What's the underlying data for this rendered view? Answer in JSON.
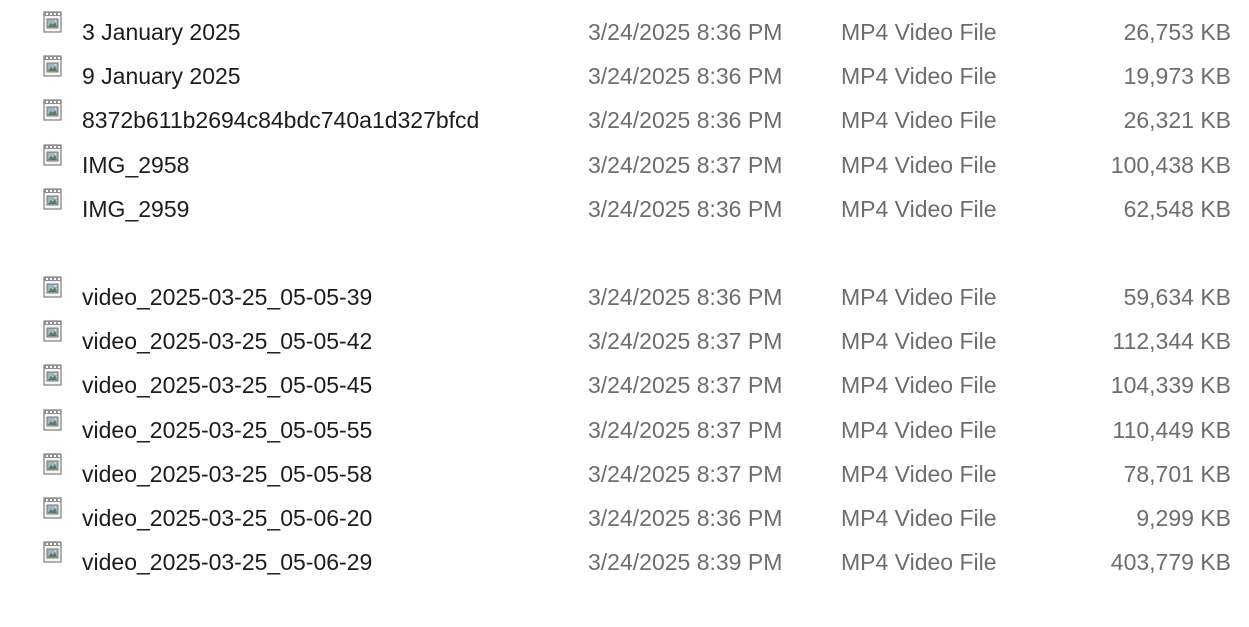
{
  "icon": "video-file-icon",
  "groups": [
    {
      "rows": [
        {
          "name": "3 January 2025",
          "date": "3/24/2025 8:36 PM",
          "type": "MP4 Video File",
          "size": "26,753 KB"
        },
        {
          "name": "9 January 2025",
          "date": "3/24/2025 8:36 PM",
          "type": "MP4 Video File",
          "size": "19,973 KB"
        },
        {
          "name": "8372b611b2694c84bdc740a1d327bfcd",
          "date": "3/24/2025 8:36 PM",
          "type": "MP4 Video File",
          "size": "26,321 KB"
        },
        {
          "name": "IMG_2958",
          "date": "3/24/2025 8:37 PM",
          "type": "MP4 Video File",
          "size": "100,438 KB"
        },
        {
          "name": "IMG_2959",
          "date": "3/24/2025 8:36 PM",
          "type": "MP4 Video File",
          "size": "62,548 KB"
        }
      ]
    },
    {
      "rows": [
        {
          "name": "video_2025-03-25_05-05-39",
          "date": "3/24/2025 8:36 PM",
          "type": "MP4 Video File",
          "size": "59,634 KB"
        },
        {
          "name": "video_2025-03-25_05-05-42",
          "date": "3/24/2025 8:37 PM",
          "type": "MP4 Video File",
          "size": "112,344 KB"
        },
        {
          "name": "video_2025-03-25_05-05-45",
          "date": "3/24/2025 8:37 PM",
          "type": "MP4 Video File",
          "size": "104,339 KB"
        },
        {
          "name": "video_2025-03-25_05-05-55",
          "date": "3/24/2025 8:37 PM",
          "type": "MP4 Video File",
          "size": "110,449 KB"
        },
        {
          "name": "video_2025-03-25_05-05-58",
          "date": "3/24/2025 8:37 PM",
          "type": "MP4 Video File",
          "size": "78,701 KB"
        },
        {
          "name": "video_2025-03-25_05-06-20",
          "date": "3/24/2025 8:36 PM",
          "type": "MP4 Video File",
          "size": "9,299 KB"
        },
        {
          "name": "video_2025-03-25_05-06-29",
          "date": "3/24/2025 8:39 PM",
          "type": "MP4 Video File",
          "size": "403,779 KB"
        }
      ]
    }
  ]
}
